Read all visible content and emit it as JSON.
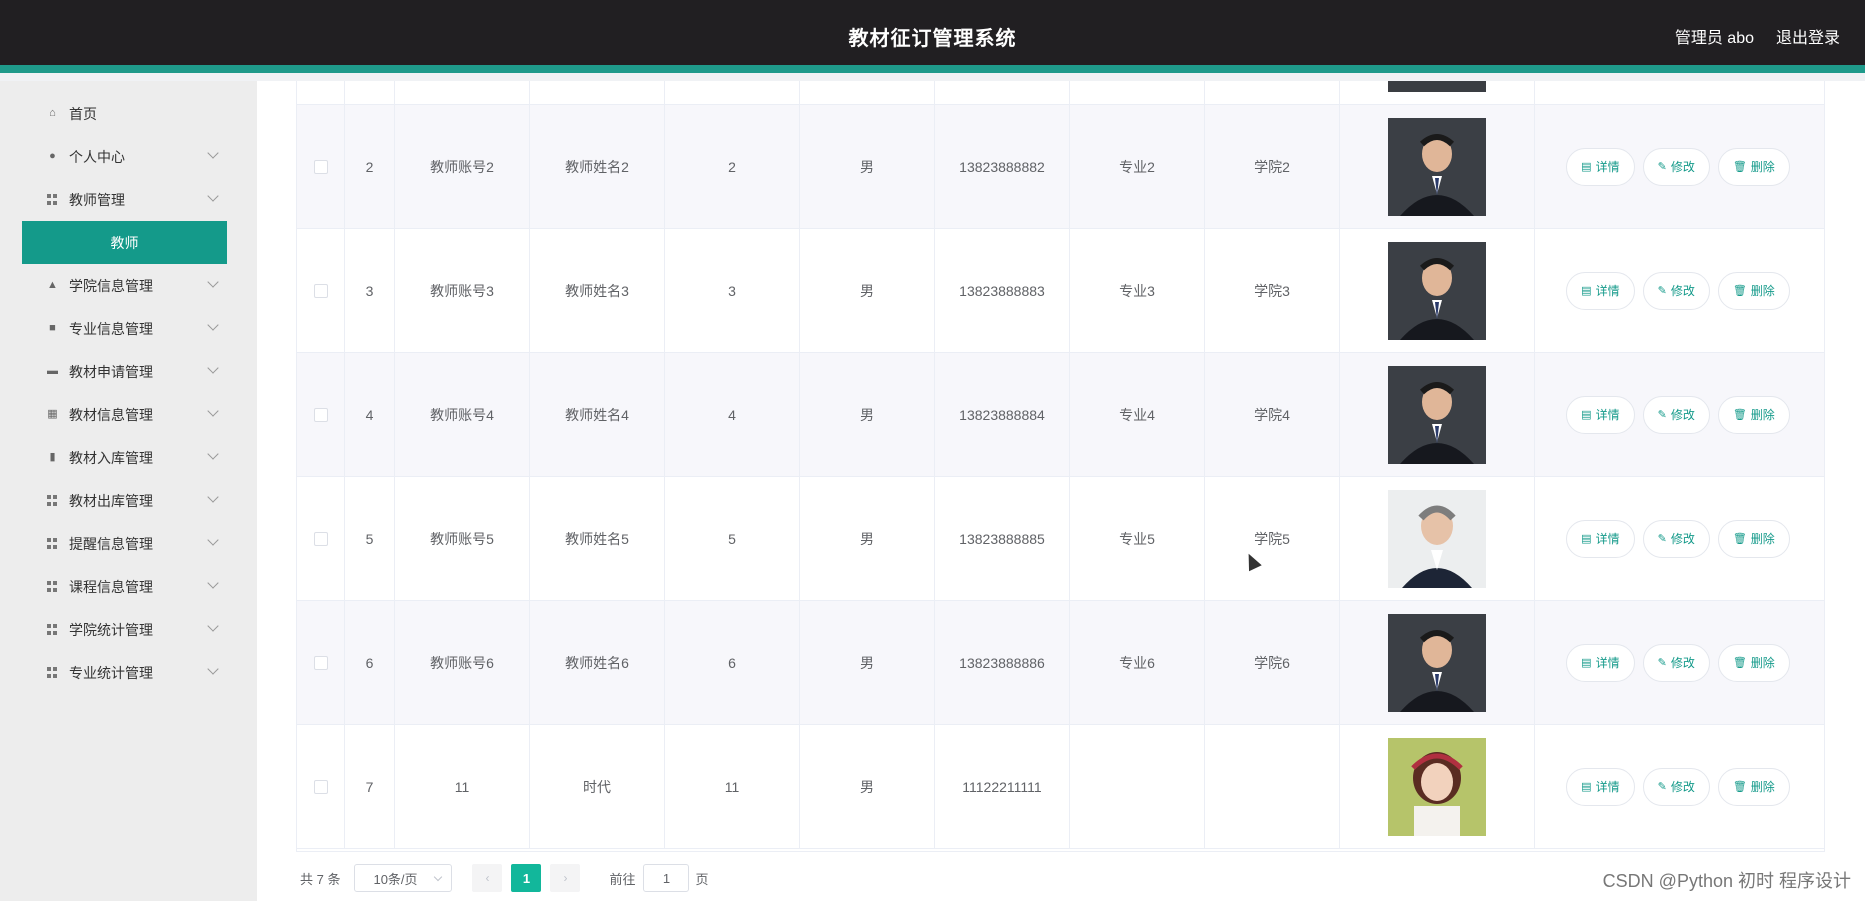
{
  "header": {
    "title": "教材征订管理系统",
    "user": "管理员 abo",
    "logout": "退出登录"
  },
  "sidebar": {
    "items": [
      {
        "label": "首页",
        "icon": "home-icon"
      },
      {
        "label": "个人中心",
        "icon": "user-icon"
      },
      {
        "label": "教师管理",
        "icon": "grid-icon"
      },
      {
        "label": "教师",
        "icon": ""
      },
      {
        "label": "学院信息管理",
        "icon": "user-icon"
      },
      {
        "label": "专业信息管理",
        "icon": "briefcase-icon"
      },
      {
        "label": "教材申请管理",
        "icon": "monitor-icon"
      },
      {
        "label": "教材信息管理",
        "icon": "chart-icon"
      },
      {
        "label": "教材入库管理",
        "icon": "bar-chart-icon"
      },
      {
        "label": "教材出库管理",
        "icon": "grid-icon"
      },
      {
        "label": "提醒信息管理",
        "icon": "grid-icon"
      },
      {
        "label": "课程信息管理",
        "icon": "grid-icon"
      },
      {
        "label": "学院统计管理",
        "icon": "grid-icon"
      },
      {
        "label": "专业统计管理",
        "icon": "grid-icon"
      }
    ]
  },
  "table": {
    "rows": [
      {
        "idx": "2",
        "account": "教师账号2",
        "name": "教师姓名2",
        "age": "2",
        "gender": "男",
        "phone": "13823888882",
        "major": "专业2",
        "college": "学院2",
        "photo": "dark"
      },
      {
        "idx": "3",
        "account": "教师账号3",
        "name": "教师姓名3",
        "age": "3",
        "gender": "男",
        "phone": "13823888883",
        "major": "专业3",
        "college": "学院3",
        "photo": "dark"
      },
      {
        "idx": "4",
        "account": "教师账号4",
        "name": "教师姓名4",
        "age": "4",
        "gender": "男",
        "phone": "13823888884",
        "major": "专业4",
        "college": "学院4",
        "photo": "dark"
      },
      {
        "idx": "5",
        "account": "教师账号5",
        "name": "教师姓名5",
        "age": "5",
        "gender": "男",
        "phone": "13823888885",
        "major": "专业5",
        "college": "学院5",
        "photo": "light"
      },
      {
        "idx": "6",
        "account": "教师账号6",
        "name": "教师姓名6",
        "age": "6",
        "gender": "男",
        "phone": "13823888886",
        "major": "专业6",
        "college": "学院6",
        "photo": "dark"
      },
      {
        "idx": "7",
        "account": "11",
        "name": "时代",
        "age": "11",
        "gender": "男",
        "phone": "11122211111",
        "major": "",
        "college": "",
        "photo": "girl"
      }
    ],
    "ops": {
      "detail": "详情",
      "edit": "修改",
      "delete": "删除"
    }
  },
  "pager": {
    "total": "共 7 条",
    "page_size": "10条/页",
    "current": "1",
    "goto_label": "前往",
    "goto_value": "1",
    "page_unit": "页"
  },
  "watermark": "CSDN @Python 初时 程序设计"
}
